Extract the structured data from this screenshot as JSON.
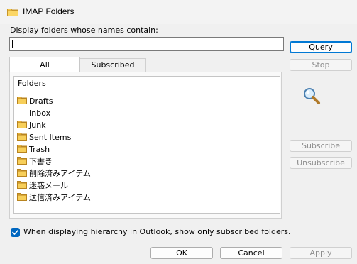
{
  "window": {
    "title": "IMAP Folders",
    "icon": "folder-icon"
  },
  "filter": {
    "label": "Display folders whose names contain:",
    "value": ""
  },
  "buttons": {
    "query": "Query",
    "stop": "Stop",
    "subscribe": "Subscribe",
    "unsubscribe": "Unsubscribe",
    "ok": "OK",
    "cancel": "Cancel",
    "apply": "Apply"
  },
  "tabs": [
    {
      "label": "All",
      "active": true
    },
    {
      "label": "Subscribed",
      "active": false
    }
  ],
  "folder_list": {
    "header": "Folders",
    "items": [
      {
        "label": "Drafts",
        "icon": "folder-icon"
      },
      {
        "label": "Inbox",
        "icon": ""
      },
      {
        "label": "Junk",
        "icon": "folder-icon"
      },
      {
        "label": "Sent Items",
        "icon": "folder-icon"
      },
      {
        "label": "Trash",
        "icon": "folder-icon"
      },
      {
        "label": "下書き",
        "icon": "folder-icon"
      },
      {
        "label": "削除済みアイテム",
        "icon": "folder-icon"
      },
      {
        "label": "迷惑メール",
        "icon": "folder-icon"
      },
      {
        "label": "送信済みアイテム",
        "icon": "folder-icon"
      }
    ]
  },
  "hierarchy_option": {
    "label": "When displaying hierarchy in Outlook, show only subscribed folders.",
    "checked": true
  },
  "colors": {
    "accent": "#0067c0",
    "folder": "#f0c24b"
  }
}
